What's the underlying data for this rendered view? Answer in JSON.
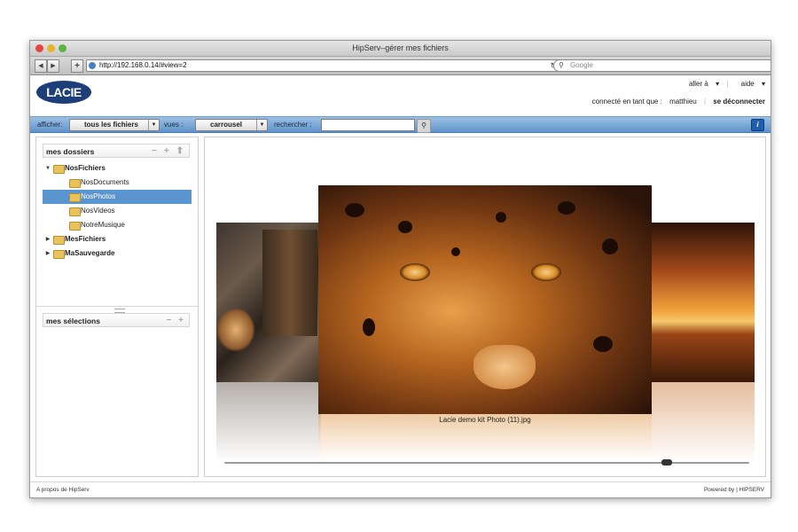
{
  "window": {
    "title": "HipServ–gérer mes fichiers"
  },
  "browser": {
    "back_icon": "back-arrow-icon",
    "forward_icon": "forward-arrow-icon",
    "add_icon": "plus-icon",
    "url": "http://192.168.0.14/#view=2",
    "search_placeholder": "Google"
  },
  "header": {
    "logo": "LACIE",
    "goto_label": "aller à",
    "help_label": "aide",
    "connected_label": "connecté en tant que :",
    "username": "matthieu",
    "logout_label": "se déconnecter"
  },
  "filterbar": {
    "show_label": "afficher:",
    "show_value": "tous les fichiers",
    "views_label": "vues :",
    "views_value": "carrousel",
    "search_label": "rechercher :",
    "search_value": ""
  },
  "sidebar": {
    "folders_title": "mes dossiers",
    "selections_title": "mes sélections",
    "tree": [
      {
        "label": "NosFichiers",
        "level": 0,
        "expanded": true
      },
      {
        "label": "NosDocuments",
        "level": 1
      },
      {
        "label": "NosPhotos",
        "level": 1,
        "selected": true
      },
      {
        "label": "NosVideos",
        "level": 1
      },
      {
        "label": "NotreMusique",
        "level": 1
      },
      {
        "label": "MesFichiers",
        "level": 0,
        "expanded": false
      },
      {
        "label": "MaSauvegarde",
        "level": 0,
        "expanded": false
      }
    ]
  },
  "carousel": {
    "caption": "Lacie demo kit Photo (11).jpg",
    "position": 0.85
  },
  "footer": {
    "about": "A propos de HipServ",
    "powered": "Powered by | HIPSERV"
  },
  "colors": {
    "accent": "#5b95cf",
    "bluebar": "#7aa7d6",
    "logo": "#1c3f7a"
  }
}
